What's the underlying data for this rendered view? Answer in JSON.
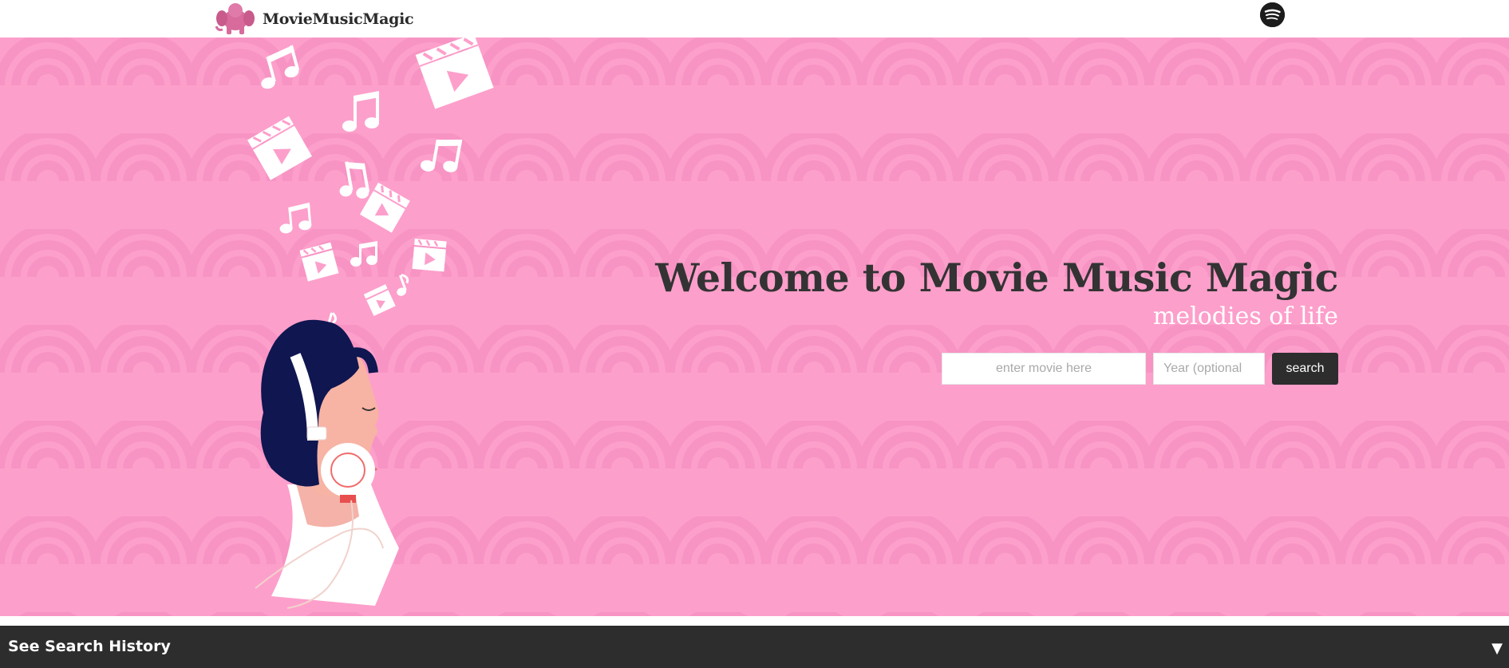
{
  "nav": {
    "brand_name": "MovieMusicMagic",
    "logo_icon": "pink-elephant-logo-icon",
    "spotify_icon": "spotify-icon"
  },
  "hero": {
    "title": "Welcome to Movie Music Magic",
    "subtitle": "melodies of life",
    "illustration": "person-with-headphones-music-notes-film-clapboards",
    "search": {
      "movie_placeholder": "enter movie here",
      "movie_value": "",
      "year_placeholder": "Year (optional",
      "year_value": "",
      "button_label": "search"
    }
  },
  "history": {
    "label": "See Search History",
    "toggle_icon": "▼"
  },
  "colors": {
    "hero_background": "#fd9fcb",
    "pattern": "#f893c2",
    "dark": "#2d2d2d",
    "title_text": "#333333",
    "hair": "#0f1650",
    "skin": "#f7b3a4"
  }
}
